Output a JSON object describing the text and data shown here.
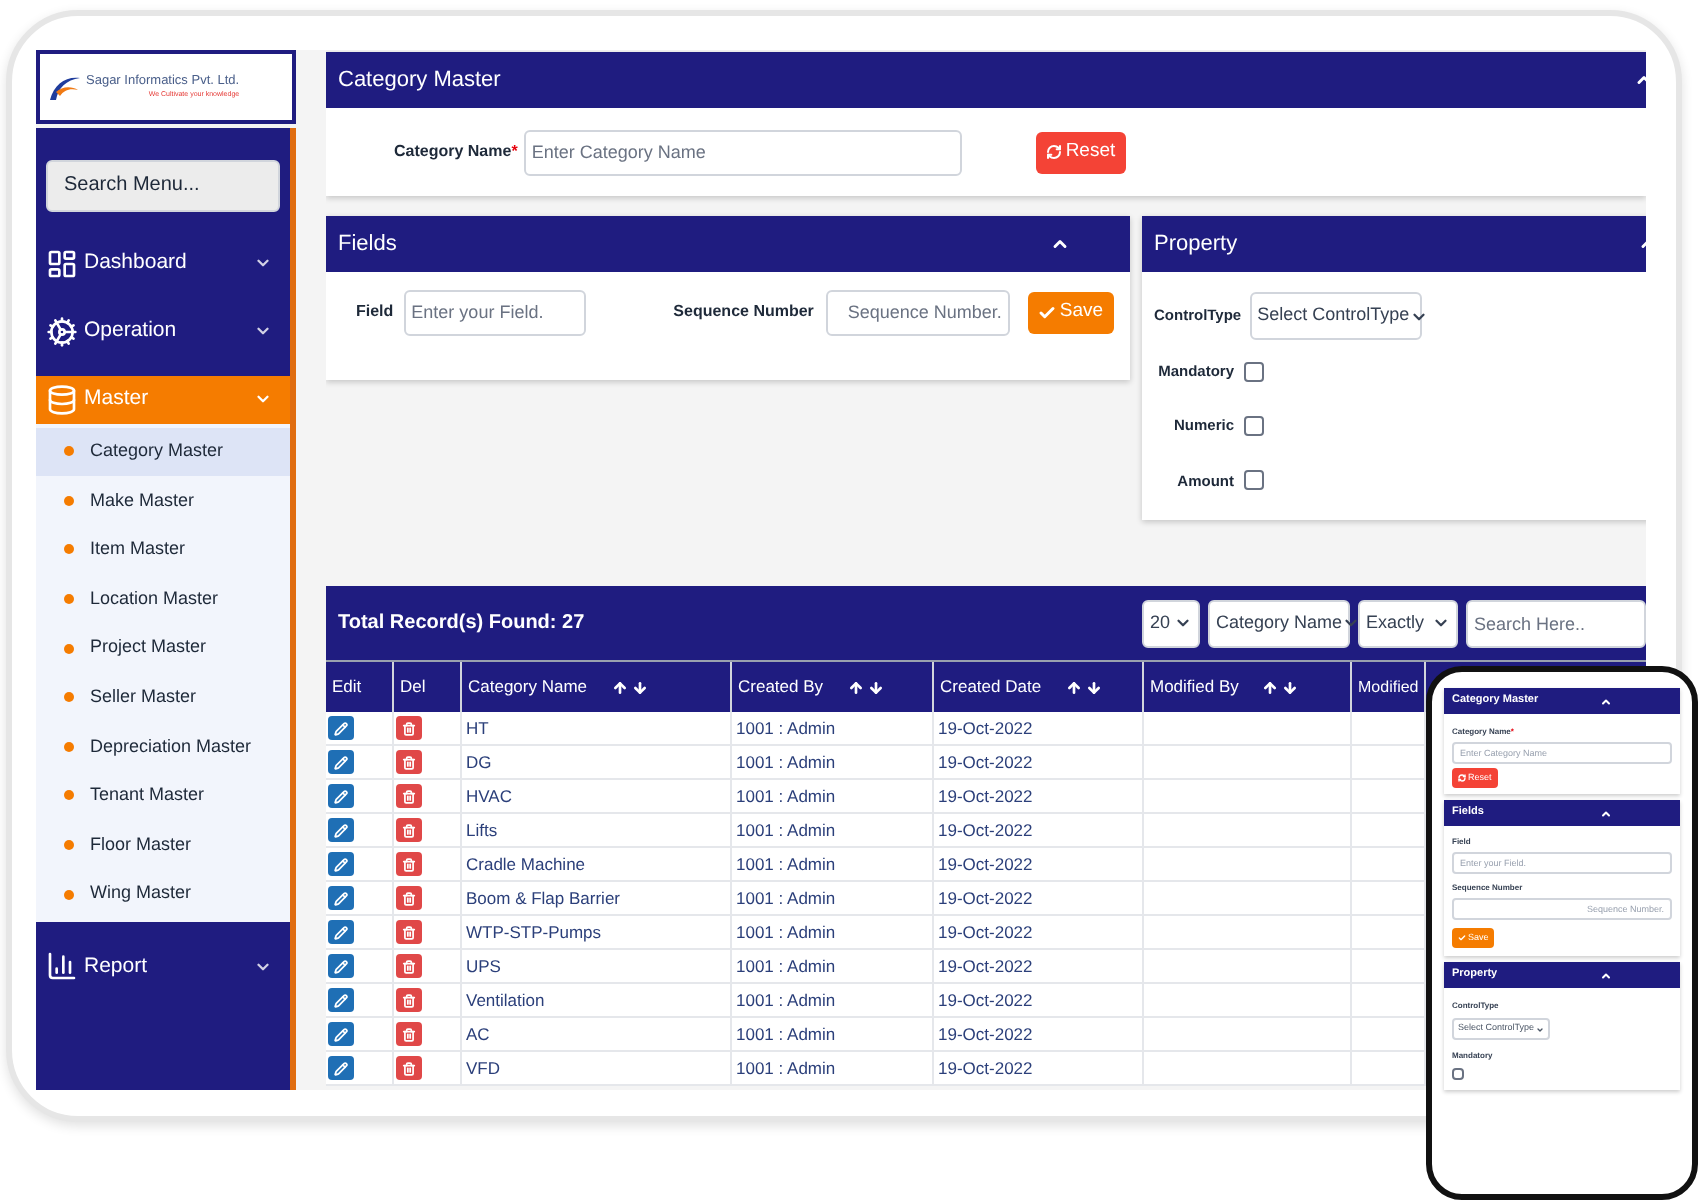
{
  "logo": {
    "name": "Sagar Informatics Pvt. Ltd.",
    "tagline": "We Cultivate your knowledge"
  },
  "sidebar": {
    "search": {
      "placeholder": "Search Menu..."
    },
    "items": [
      {
        "label": "Dashboard",
        "kind": "dashboard",
        "selected": false,
        "expanded": false
      },
      {
        "label": "Operation",
        "kind": "gears",
        "selected": false,
        "expanded": false
      },
      {
        "label": "Master",
        "kind": "database",
        "selected": true,
        "expanded": true,
        "children": [
          {
            "label": "Category Master",
            "selected": true
          },
          {
            "label": "Make Master",
            "selected": false
          },
          {
            "label": "Item Master",
            "selected": false
          },
          {
            "label": "Location Master",
            "selected": false
          },
          {
            "label": "Project Master",
            "selected": false
          },
          {
            "label": "Seller Master",
            "selected": false
          },
          {
            "label": "Depreciation Master",
            "selected": false
          },
          {
            "label": "Tenant Master",
            "selected": false
          },
          {
            "label": "Floor Master",
            "selected": false
          },
          {
            "label": "Wing Master",
            "selected": false
          }
        ]
      },
      {
        "label": "Report",
        "kind": "report",
        "selected": false,
        "expanded": false
      }
    ]
  },
  "category_card": {
    "title": "Category Master",
    "label": "Category Name",
    "required_mark": "*",
    "placeholder": "Enter Category Name",
    "button": "Reset"
  },
  "fields_card": {
    "title": "Fields",
    "field_label": "Field",
    "field_placeholder": "Enter your Field.",
    "sequence_label": "Sequence Number",
    "sequence_placeholder": "Sequence Number.",
    "button": "Save"
  },
  "property_card": {
    "title": "Property",
    "control_label": "ControlType",
    "control_value": "Select ControlType",
    "checks": [
      {
        "label": "Mandatory",
        "checked": false
      },
      {
        "label": "Numeric",
        "checked": false
      },
      {
        "label": "Amount",
        "checked": false
      }
    ]
  },
  "table": {
    "total": "Total Record(s) Found: 27",
    "page_size": "20",
    "search_column": "Category Name",
    "match": "Exactly",
    "search_placeholder": "Search Here..",
    "columns": [
      {
        "label": "Edit",
        "sortable": false
      },
      {
        "label": "Del",
        "sortable": false
      },
      {
        "label": "Category Name",
        "sortable": true
      },
      {
        "label": "Created By",
        "sortable": true
      },
      {
        "label": "Created Date",
        "sortable": true
      },
      {
        "label": "Modified By",
        "sortable": true
      },
      {
        "label": "Modified"
      }
    ],
    "rows": [
      {
        "name": "HT",
        "created_by": "1001 : Admin",
        "created_date": "19-Oct-2022"
      },
      {
        "name": "DG",
        "created_by": "1001 : Admin",
        "created_date": "19-Oct-2022"
      },
      {
        "name": "HVAC",
        "created_by": "1001 : Admin",
        "created_date": "19-Oct-2022"
      },
      {
        "name": "Lifts",
        "created_by": "1001 : Admin",
        "created_date": "19-Oct-2022"
      },
      {
        "name": "Cradle Machine",
        "created_by": "1001 : Admin",
        "created_date": "19-Oct-2022"
      },
      {
        "name": "Boom & Flap Barrier",
        "created_by": "1001 : Admin",
        "created_date": "19-Oct-2022"
      },
      {
        "name": "WTP-STP-Pumps",
        "created_by": "1001 : Admin",
        "created_date": "19-Oct-2022"
      },
      {
        "name": "UPS",
        "created_by": "1001 : Admin",
        "created_date": "19-Oct-2022"
      },
      {
        "name": "Ventilation",
        "created_by": "1001 : Admin",
        "created_date": "19-Oct-2022"
      },
      {
        "name": "AC",
        "created_by": "1001 : Admin",
        "created_date": "19-Oct-2022"
      },
      {
        "name": "VFD",
        "created_by": "1001 : Admin",
        "created_date": "19-Oct-2022"
      }
    ]
  },
  "phone": {
    "category_title": "Category Master",
    "category_label": "Category Name",
    "required_mark": "*",
    "category_placeholder": "Enter Category Name",
    "reset": "Reset",
    "fields_title": "Fields",
    "field_label": "Field",
    "field_placeholder": "Enter your Field.",
    "sequence_label": "Sequence Number",
    "sequence_placeholder": "Sequence Number.",
    "save": "Save",
    "property_title": "Property",
    "control_label": "ControlType",
    "control_value": "Select ControlType",
    "mandatory_label": "Mandatory",
    "mandatory_checked": false
  }
}
